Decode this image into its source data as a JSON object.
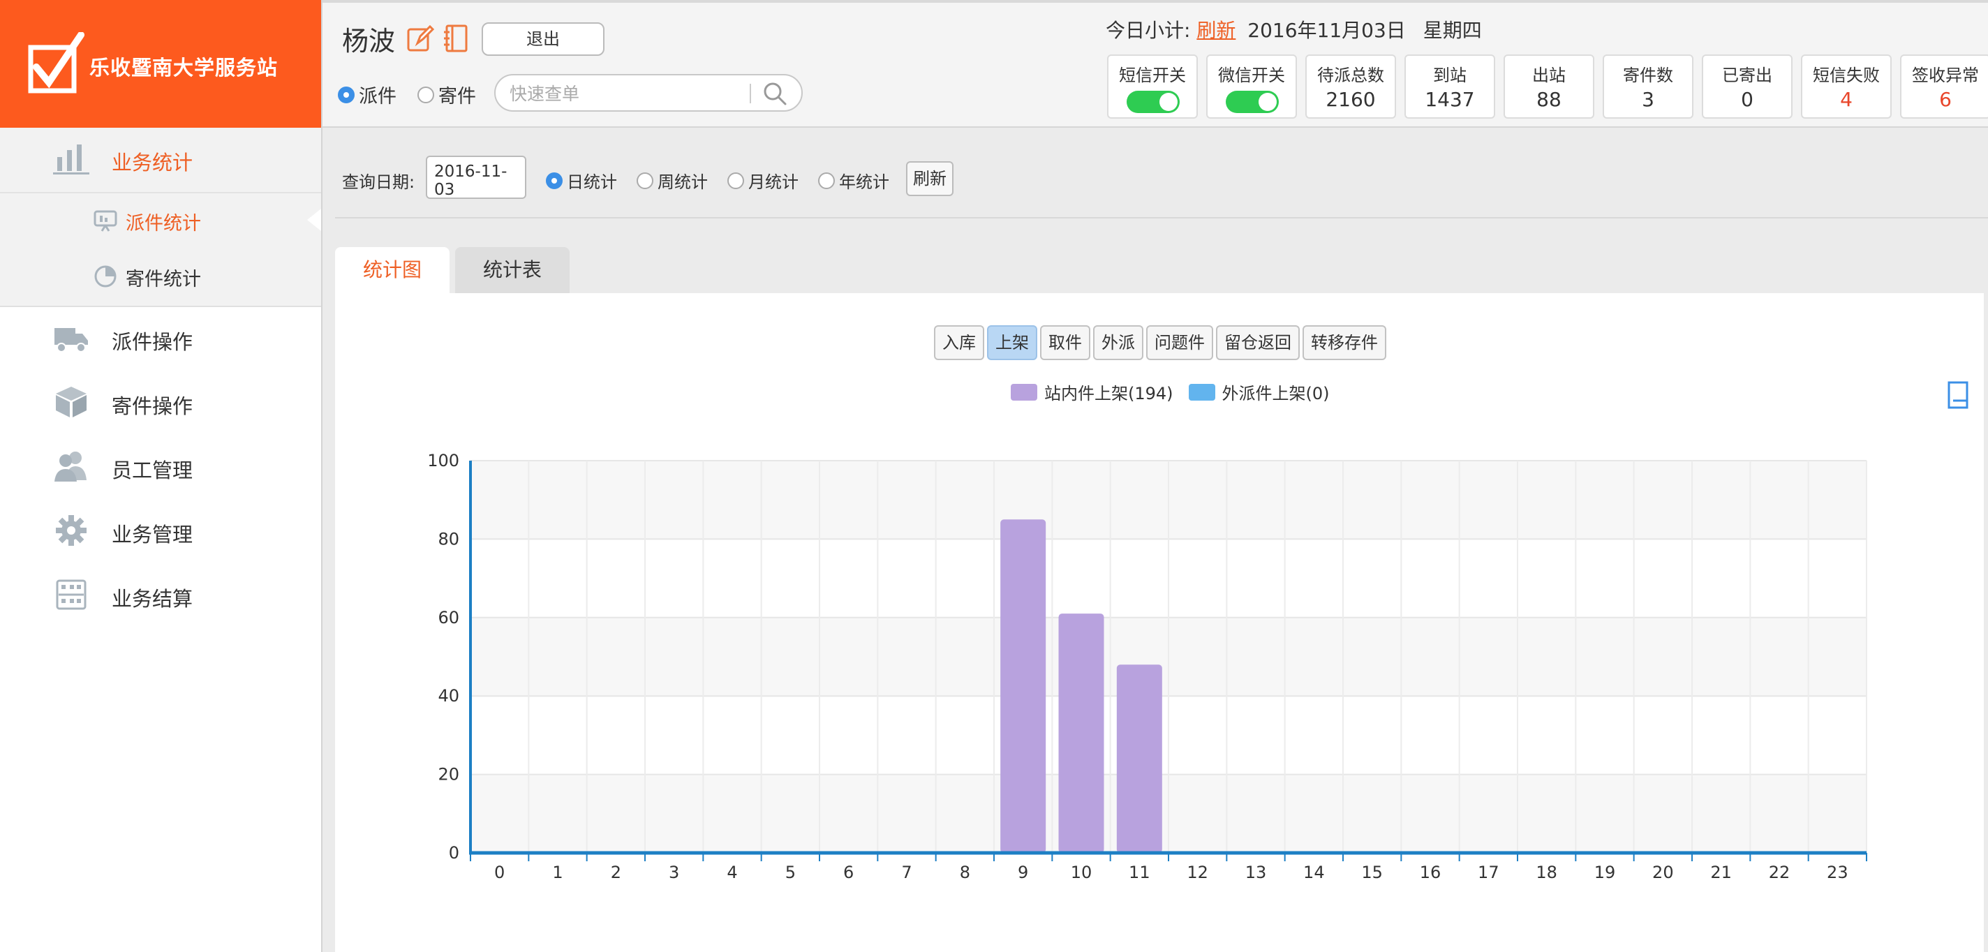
{
  "app": {
    "logo_text": "乐收暨南大学服务站",
    "brand_color": "#fd5a1e",
    "accent_color": "#ee5f24"
  },
  "sidebar": {
    "items": [
      {
        "label": "业务统计",
        "icon": "bar-chart-icon",
        "active": true,
        "children": [
          {
            "label": "派件统计",
            "icon": "presentation-icon",
            "active": true
          },
          {
            "label": "寄件统计",
            "icon": "pie-icon",
            "active": false
          }
        ]
      },
      {
        "label": "派件操作",
        "icon": "truck-icon"
      },
      {
        "label": "寄件操作",
        "icon": "box-icon"
      },
      {
        "label": "员工管理",
        "icon": "users-icon"
      },
      {
        "label": "业务管理",
        "icon": "gear-icon"
      },
      {
        "label": "业务结算",
        "icon": "abacus-icon"
      }
    ]
  },
  "header": {
    "user_name": "杨波",
    "logout_label": "退出",
    "mode_options": [
      "派件",
      "寄件"
    ],
    "mode_selected": "派件",
    "search_placeholder": "快速查单",
    "today_label": "今日小计:",
    "refresh_link": "刷新",
    "date": "2016年11月03日",
    "weekday": "星期四",
    "stats": [
      {
        "label": "短信开关",
        "toggle": true
      },
      {
        "label": "微信开关",
        "toggle": true
      },
      {
        "label": "待派总数",
        "value": "2160"
      },
      {
        "label": "到站",
        "value": "1437"
      },
      {
        "label": "出站",
        "value": "88"
      },
      {
        "label": "寄件数",
        "value": "3"
      },
      {
        "label": "已寄出",
        "value": "0"
      },
      {
        "label": "短信失败",
        "value": "4",
        "alert": true
      },
      {
        "label": "签收异常",
        "value": "6",
        "alert": true
      }
    ]
  },
  "filter": {
    "date_label": "查询日期:",
    "date_value": "2016-11-03",
    "period_options": [
      "日统计",
      "周统计",
      "月统计",
      "年统计"
    ],
    "period_selected": "日统计",
    "refresh_label": "刷新"
  },
  "tabs": [
    "统计图",
    "统计表"
  ],
  "active_tab": "统计图",
  "chart_buttons": [
    "入库",
    "上架",
    "取件",
    "外派",
    "问题件",
    "留仓返回",
    "转移存件"
  ],
  "chart_button_active": "上架",
  "chart_data": {
    "type": "bar",
    "categories": [
      "0",
      "1",
      "2",
      "3",
      "4",
      "5",
      "6",
      "7",
      "8",
      "9",
      "10",
      "11",
      "12",
      "13",
      "14",
      "15",
      "16",
      "17",
      "18",
      "19",
      "20",
      "21",
      "22",
      "23"
    ],
    "series": [
      {
        "name": "站内件上架(194)",
        "color": "#b8a2de",
        "values": [
          0,
          0,
          0,
          0,
          0,
          0,
          0,
          0,
          0,
          85,
          61,
          48,
          0,
          0,
          0,
          0,
          0,
          0,
          0,
          0,
          0,
          0,
          0,
          0
        ]
      },
      {
        "name": "外派件上架(0)",
        "color": "#62b4ee",
        "values": [
          0,
          0,
          0,
          0,
          0,
          0,
          0,
          0,
          0,
          0,
          0,
          0,
          0,
          0,
          0,
          0,
          0,
          0,
          0,
          0,
          0,
          0,
          0,
          0
        ]
      }
    ],
    "ylim": [
      0,
      100
    ],
    "yticks": [
      0,
      20,
      40,
      60,
      80,
      100
    ],
    "grid": true,
    "legend": "top-center"
  }
}
